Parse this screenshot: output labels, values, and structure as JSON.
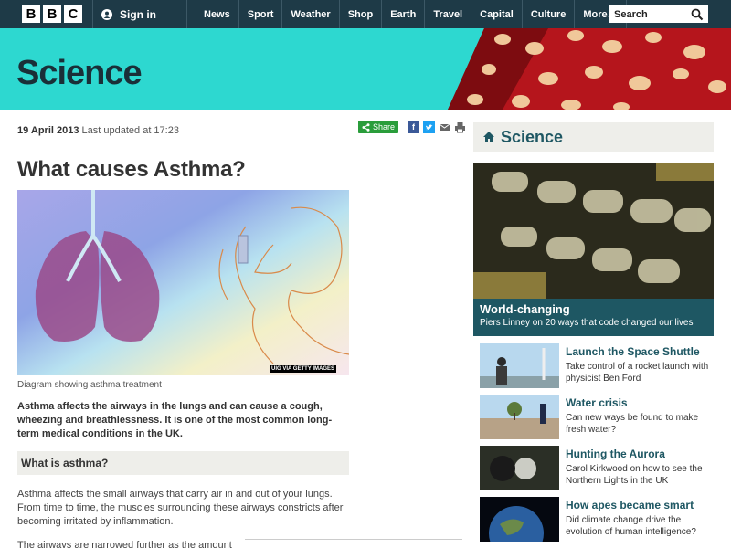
{
  "topbar": {
    "logo_letters": [
      "B",
      "B",
      "C"
    ],
    "signin_label": "Sign in",
    "nav": [
      "News",
      "Sport",
      "Weather",
      "Shop",
      "Earth",
      "Travel",
      "Capital",
      "Culture",
      "More…"
    ],
    "search_placeholder": "Search"
  },
  "banner": {
    "title": "Science"
  },
  "article": {
    "date": "19 April 2013",
    "updated": "Last updated at 17:23",
    "share_label": "Share",
    "headline": "What causes Asthma?",
    "image_credit": "UIG VIA GETTY IMAGES",
    "caption": "Diagram showing asthma treatment",
    "intro": "Asthma affects the airways in the lungs and can cause a cough, wheezing and breathlessness. It is one of the most common long-term medical conditions in the UK.",
    "subheading": "What is asthma?",
    "para1": "Asthma affects the small airways that carry air in and out of your lungs. From time to time, the muscles surrounding these airways constricts after becoming irritated by inflammation.",
    "para2": "The airways are narrowed further as the amount"
  },
  "sidebar": {
    "title": "Science",
    "feature": {
      "title": "World-changing",
      "desc": "Piers Linney on 20 ways that code changed our lives"
    },
    "items": [
      {
        "title": "Launch the Space Shuttle",
        "desc": "Take control of a rocket launch with physicist Ben Ford"
      },
      {
        "title": "Water crisis",
        "desc": "Can new ways be found to make fresh water?"
      },
      {
        "title": "Hunting the Aurora",
        "desc": "Carol Kirkwood on how to see the Northern Lights in the UK"
      },
      {
        "title": "How apes became smart",
        "desc": "Did climate change drive the evolution of human intelligence?"
      }
    ]
  },
  "colors": {
    "nav_bg": "#1e3a47",
    "banner_bg": "#2dd8d0",
    "accent": "#1e5763",
    "share_green": "#2a9d3b"
  }
}
